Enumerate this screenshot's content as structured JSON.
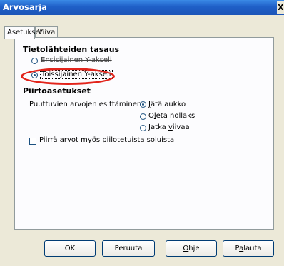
{
  "window": {
    "title": "Arvosarja",
    "close_label": "X"
  },
  "tabs": [
    {
      "label": "Asetukset"
    },
    {
      "label": "Viiva"
    }
  ],
  "section_source": {
    "heading": "Tietolähteiden tasaus",
    "option_primary": "Ensisijainen Y-akseli",
    "option_secondary": "Toissijainen Y-akseli",
    "selected": "secondary"
  },
  "section_plot": {
    "heading": "Piirtoasetukset",
    "missing_label": "Puuttuvien arvojen esittäminen",
    "option_gap": {
      "pre": "",
      "mnemonic": "J",
      "post": "ätä aukko"
    },
    "option_zero": {
      "pre": "O",
      "mnemonic": "l",
      "post": "eta nollaksi"
    },
    "option_continue": {
      "pre": "Jatka ",
      "mnemonic": "v",
      "post": "iivaa"
    },
    "selected": "gap",
    "hidden_cells": {
      "pre": "Piirrä ",
      "mnemonic": "a",
      "post": "rvot myös piilotetuista soluista",
      "checked": false
    }
  },
  "buttons": {
    "ok": {
      "label": "OK"
    },
    "cancel": {
      "label": "Peruuta"
    },
    "help": {
      "pre": "",
      "mnemonic": "O",
      "post": "hje"
    },
    "reset": {
      "pre": "P",
      "mnemonic": "a",
      "post": "lauta"
    }
  },
  "colors": {
    "annotation": "#e2231a",
    "titlebar": "#1f5fc7"
  }
}
